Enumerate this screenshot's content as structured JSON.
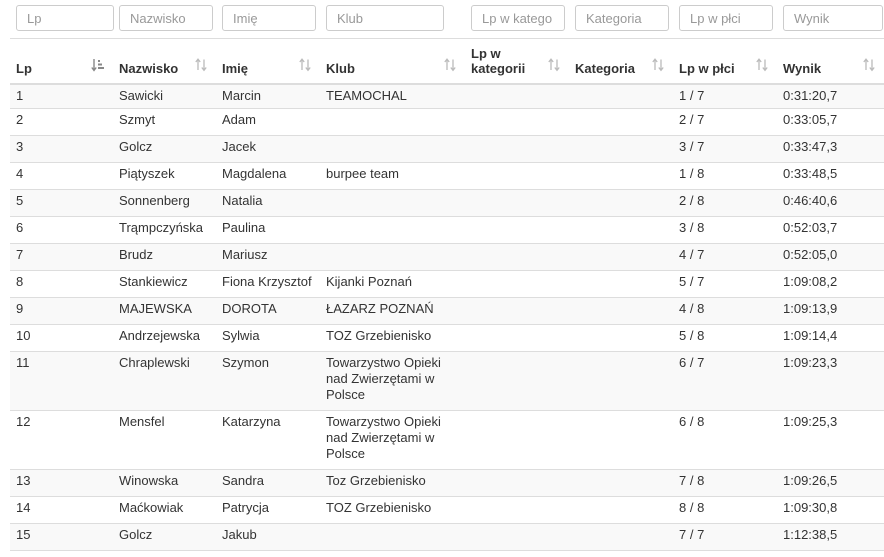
{
  "filters": [
    {
      "key": "lp",
      "placeholder": "Lp"
    },
    {
      "key": "nazwisko",
      "placeholder": "Nazwisko"
    },
    {
      "key": "imie",
      "placeholder": "Imię"
    },
    {
      "key": "klub",
      "placeholder": "Klub"
    },
    {
      "key": "lpkat",
      "placeholder": "Lp w katego"
    },
    {
      "key": "kategoria",
      "placeholder": "Kategoria"
    },
    {
      "key": "lpplci",
      "placeholder": "Lp w płci"
    },
    {
      "key": "wynik",
      "placeholder": "Wynik"
    }
  ],
  "columns": [
    {
      "key": "lp",
      "label": "Lp",
      "sort": "asc",
      "sort_icon": "sort-numeric-asc-icon"
    },
    {
      "key": "nazwisko",
      "label": "Nazwisko",
      "sort": "none",
      "sort_icon": "sort-both-icon"
    },
    {
      "key": "imie",
      "label": "Imię",
      "sort": "none",
      "sort_icon": "sort-both-icon"
    },
    {
      "key": "klub",
      "label": "Klub",
      "sort": "none",
      "sort_icon": "sort-both-icon"
    },
    {
      "key": "lpkat",
      "label": "Lp w kategorii",
      "sort": "none",
      "sort_icon": "sort-both-icon"
    },
    {
      "key": "kategoria",
      "label": "Kategoria",
      "sort": "none",
      "sort_icon": "sort-both-icon"
    },
    {
      "key": "lpplci",
      "label": "Lp w płci",
      "sort": "none",
      "sort_icon": "sort-both-icon"
    },
    {
      "key": "wynik",
      "label": "Wynik",
      "sort": "none",
      "sort_icon": "sort-both-icon"
    }
  ],
  "rows": [
    {
      "lp": "1",
      "nazwisko": "Sawicki",
      "imie": "Marcin",
      "klub": "TEAMOCHAL",
      "lpkat": "",
      "kategoria": "",
      "lpplci": "1 / 7",
      "wynik": "0:31:20,7"
    },
    {
      "lp": "2",
      "nazwisko": "Szmyt",
      "imie": "Adam",
      "klub": "",
      "lpkat": "",
      "kategoria": "",
      "lpplci": "2 / 7",
      "wynik": "0:33:05,7"
    },
    {
      "lp": "3",
      "nazwisko": "Golcz",
      "imie": "Jacek",
      "klub": "",
      "lpkat": "",
      "kategoria": "",
      "lpplci": "3 / 7",
      "wynik": "0:33:47,3"
    },
    {
      "lp": "4",
      "nazwisko": "Piątyszek",
      "imie": "Magdalena",
      "klub": "burpee team",
      "lpkat": "",
      "kategoria": "",
      "lpplci": "1 / 8",
      "wynik": "0:33:48,5"
    },
    {
      "lp": "5",
      "nazwisko": "Sonnenberg",
      "imie": "Natalia",
      "klub": "",
      "lpkat": "",
      "kategoria": "",
      "lpplci": "2 / 8",
      "wynik": "0:46:40,6"
    },
    {
      "lp": "6",
      "nazwisko": "Trąmpczyńska",
      "imie": "Paulina",
      "klub": "",
      "lpkat": "",
      "kategoria": "",
      "lpplci": "3 / 8",
      "wynik": "0:52:03,7"
    },
    {
      "lp": "7",
      "nazwisko": "Brudz",
      "imie": "Mariusz",
      "klub": "",
      "lpkat": "",
      "kategoria": "",
      "lpplci": "4 / 7",
      "wynik": "0:52:05,0"
    },
    {
      "lp": "8",
      "nazwisko": "Stankiewicz",
      "imie": "Fiona Krzysztof",
      "klub": "Kijanki Poznań",
      "lpkat": "",
      "kategoria": "",
      "lpplci": "5 / 7",
      "wynik": "1:09:08,2"
    },
    {
      "lp": "9",
      "nazwisko": "MAJEWSKA",
      "imie": "DOROTA",
      "klub": "ŁAZARZ POZNAŃ",
      "lpkat": "",
      "kategoria": "",
      "lpplci": "4 / 8",
      "wynik": "1:09:13,9"
    },
    {
      "lp": "10",
      "nazwisko": "Andrzejewska",
      "imie": "Sylwia",
      "klub": "TOZ Grzebienisko",
      "lpkat": "",
      "kategoria": "",
      "lpplci": "5 / 8",
      "wynik": "1:09:14,4"
    },
    {
      "lp": "11",
      "nazwisko": "Chraplewski",
      "imie": "Szymon",
      "klub": "Towarzystwo Opieki nad Zwierzętami w Polsce",
      "lpkat": "",
      "kategoria": "",
      "lpplci": "6 / 7",
      "wynik": "1:09:23,3"
    },
    {
      "lp": "12",
      "nazwisko": "Mensfel",
      "imie": "Katarzyna",
      "klub": "Towarzystwo Opieki nad Zwierzętami w Polsce",
      "lpkat": "",
      "kategoria": "",
      "lpplci": "6 / 8",
      "wynik": "1:09:25,3"
    },
    {
      "lp": "13",
      "nazwisko": "Winowska",
      "imie": "Sandra",
      "klub": "Toz Grzebienisko",
      "lpkat": "",
      "kategoria": "",
      "lpplci": "7 / 8",
      "wynik": "1:09:26,5"
    },
    {
      "lp": "14",
      "nazwisko": "Maćkowiak",
      "imie": "Patrycja",
      "klub": "TOZ Grzebienisko",
      "lpkat": "",
      "kategoria": "",
      "lpplci": "8 / 8",
      "wynik": "1:09:30,8"
    },
    {
      "lp": "15",
      "nazwisko": "Golcz",
      "imie": "Jakub",
      "klub": "",
      "lpkat": "",
      "kategoria": "",
      "lpplci": "7 / 7",
      "wynik": "1:12:38,5"
    }
  ],
  "colors": {
    "border": "#dddddd",
    "stripe": "#f9f9f9",
    "text": "#333333",
    "icon": "#bbbbbb",
    "icon_active": "#888888"
  }
}
